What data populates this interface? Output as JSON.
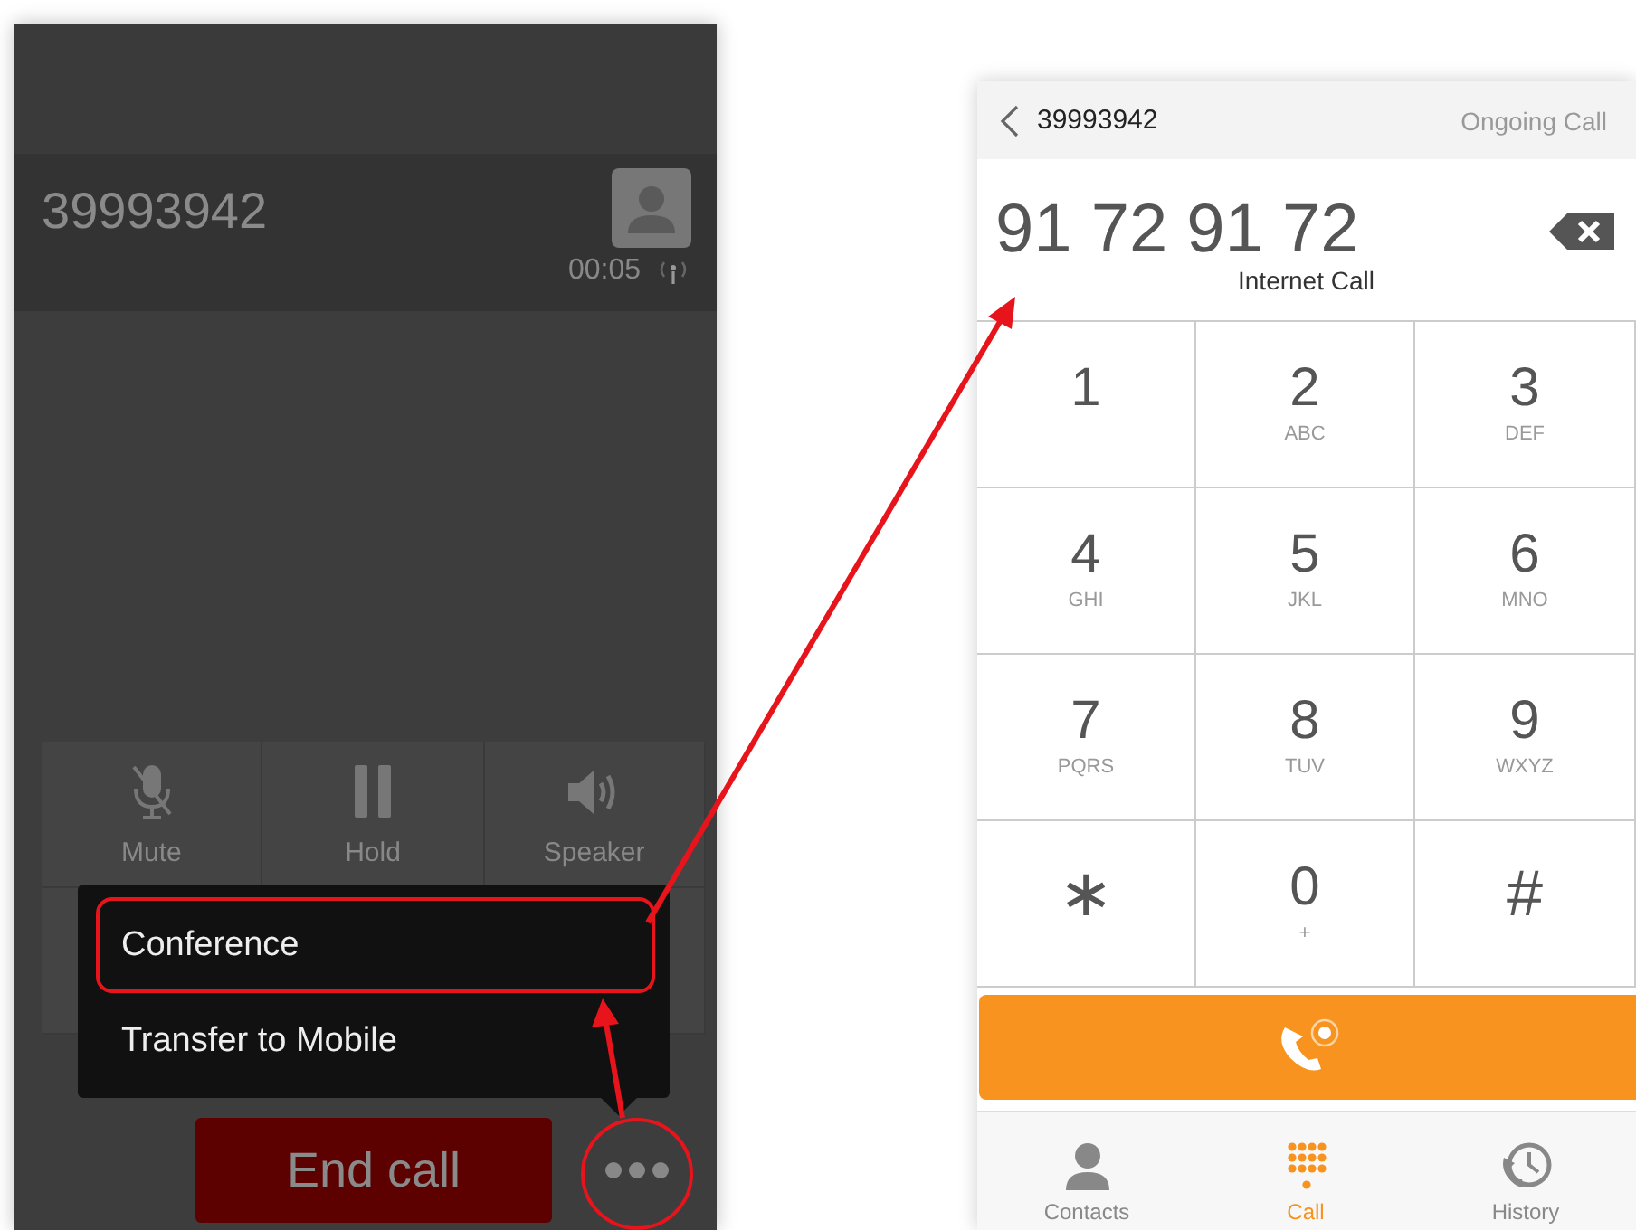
{
  "call_screen": {
    "number": "39993942",
    "duration": "00:05",
    "actions": [
      {
        "label": "Mute"
      },
      {
        "label": "Hold"
      },
      {
        "label": "Speaker"
      }
    ],
    "menu": [
      {
        "label": "Conference",
        "annotated": true
      },
      {
        "label": "Transfer to Mobile",
        "annotated": false
      }
    ],
    "end_call": "End call"
  },
  "dialer": {
    "title": "39993942",
    "status": "Ongoing Call",
    "entered_number": "91 72 91 72",
    "call_type": "Internet Call",
    "keys": [
      {
        "digit": "1"
      },
      {
        "digit": "2",
        "letters": "ABC"
      },
      {
        "digit": "3",
        "letters": "DEF"
      },
      {
        "digit": "4",
        "letters": "GHI"
      },
      {
        "digit": "5",
        "letters": "JKL"
      },
      {
        "digit": "6",
        "letters": "MNO"
      },
      {
        "digit": "7",
        "letters": "PQRS"
      },
      {
        "digit": "8",
        "letters": "TUV"
      },
      {
        "digit": "9",
        "letters": "WXYZ"
      },
      {
        "digit": "∗"
      },
      {
        "digit": "0",
        "letters": "+"
      },
      {
        "digit": "#"
      }
    ],
    "tabs": [
      {
        "label": "Contacts",
        "selected": false
      },
      {
        "label": "Call",
        "selected": true
      },
      {
        "label": "History",
        "selected": false
      }
    ]
  }
}
